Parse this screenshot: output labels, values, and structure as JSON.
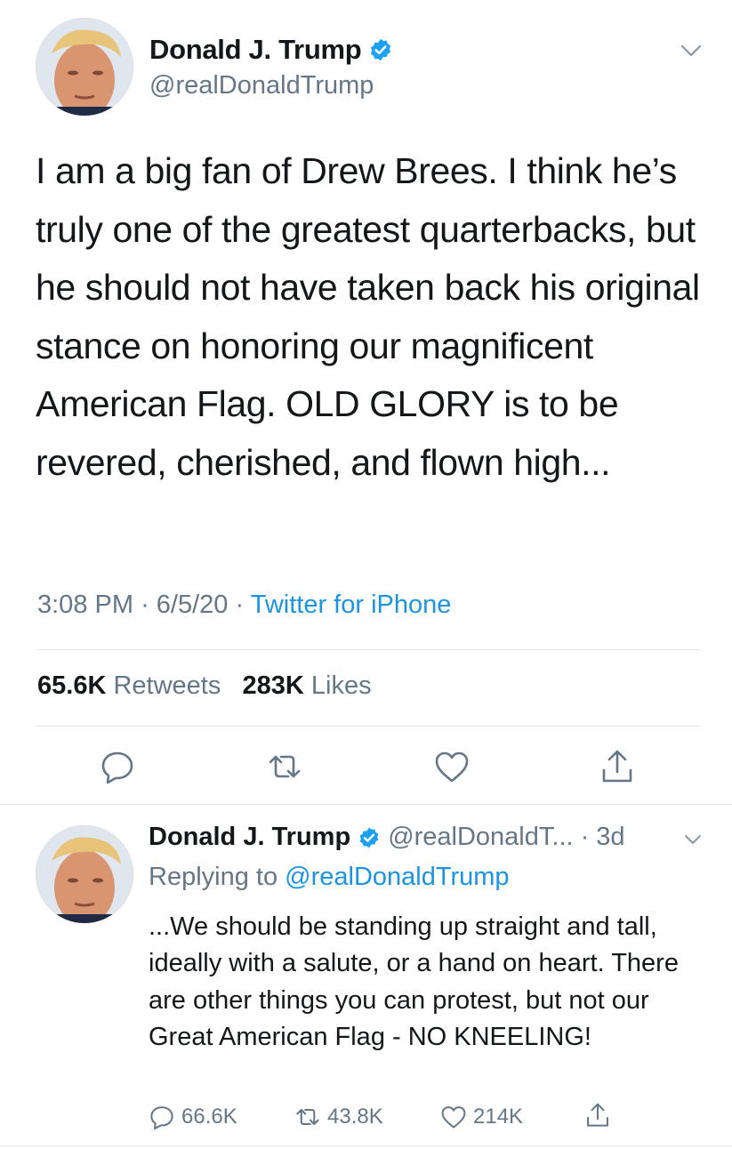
{
  "main_tweet": {
    "author_name": "Donald J. Trump",
    "handle": "@realDonaldTrump",
    "text": "I am a big fan of Drew Brees. I think he’s truly one of the greatest quarterbacks, but he should not have taken back his original stance on honoring our magnificent American Flag. OLD GLORY is to be revered, cherished, and flown high...",
    "time": "3:08 PM",
    "separator": "·",
    "date": "6/5/20",
    "source": "Twitter for iPhone",
    "retweets_count": "65.6K",
    "retweets_label": "Retweets",
    "likes_count": "283K",
    "likes_label": "Likes"
  },
  "reply_tweet": {
    "author_name": "Donald J. Trump",
    "handle": "@realDonaldT...",
    "age": "· 3d",
    "replying_to_label": "Replying to",
    "replying_to_handle": "@realDonaldTrump",
    "text": "...We should be standing up straight and tall, ideally with a salute, or a hand on heart. There are other things you can protest, but not our Great American Flag - NO KNEELING!",
    "reply_count": "66.6K",
    "retweet_count": "43.8K",
    "like_count": "214K"
  },
  "icons": {
    "verified": "verified-badge-icon",
    "chevron": "chevron-down-icon",
    "reply": "reply-icon",
    "retweet": "retweet-icon",
    "like": "heart-icon",
    "share": "share-icon"
  },
  "colors": {
    "text": "#14171a",
    "secondary": "#657786",
    "link": "#1b95e0",
    "divider": "#e1e8ed",
    "verified": "#1da1f2"
  }
}
